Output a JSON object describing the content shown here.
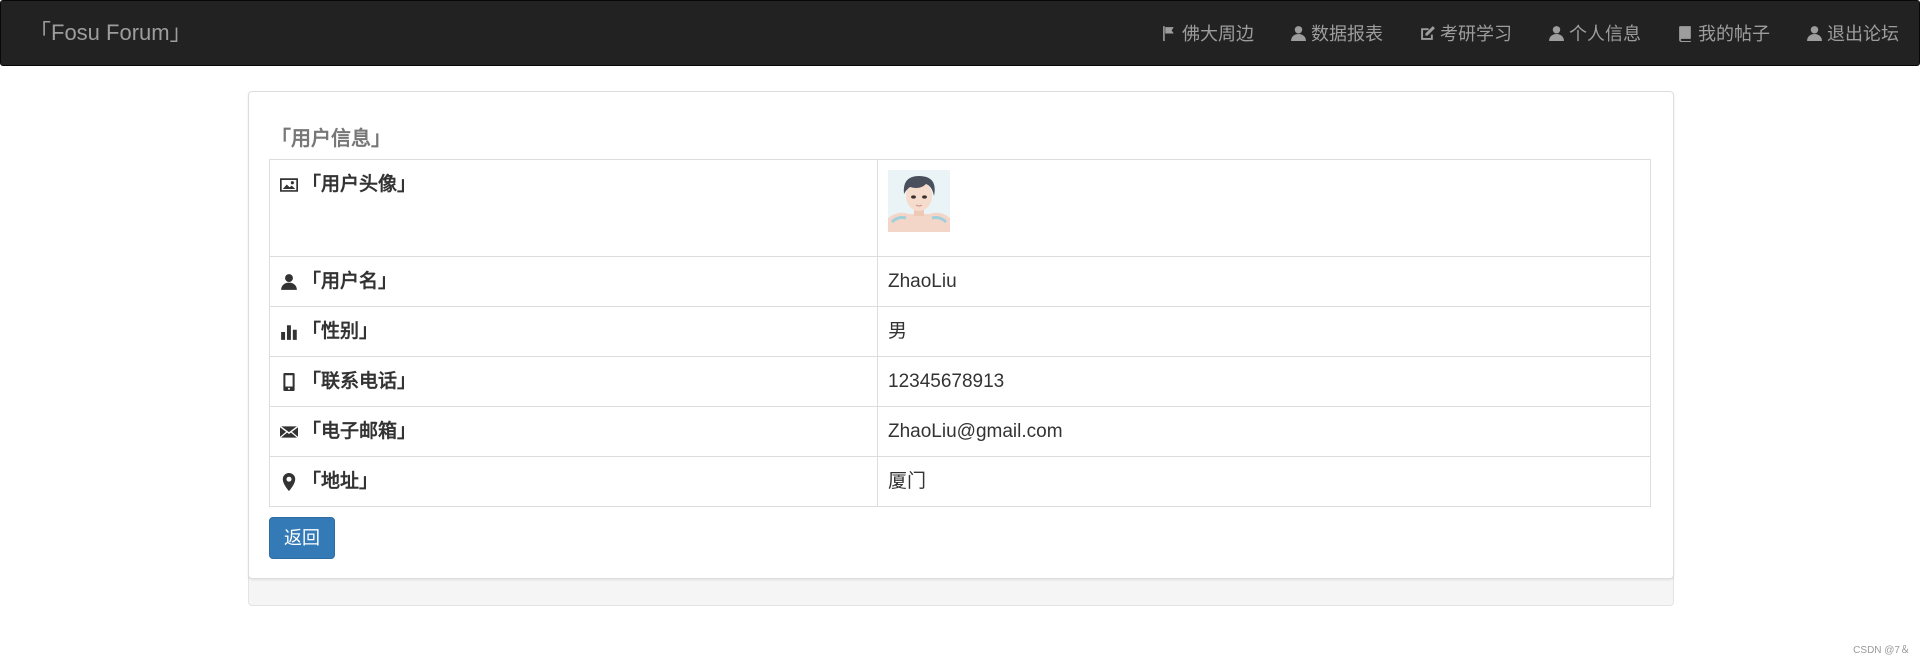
{
  "navbar": {
    "brand": "「Fosu Forum」",
    "items": [
      {
        "label": "佛大周边",
        "icon": "flag-icon"
      },
      {
        "label": "数据报表",
        "icon": "user-icon"
      },
      {
        "label": "考研学习",
        "icon": "edit-icon"
      },
      {
        "label": "个人信息",
        "icon": "user-icon"
      },
      {
        "label": "我的帖子",
        "icon": "book-icon"
      },
      {
        "label": "退出论坛",
        "icon": "user-icon"
      }
    ]
  },
  "panel": {
    "title": "「用户信息」",
    "rows": [
      {
        "label": "「用户头像」",
        "icon": "picture-icon",
        "value": ""
      },
      {
        "label": "「用户名」",
        "icon": "user-icon",
        "value": "ZhaoLiu"
      },
      {
        "label": "「性别」",
        "icon": "stats-icon",
        "value": "男"
      },
      {
        "label": "「联系电话」",
        "icon": "phone-icon",
        "value": "12345678913"
      },
      {
        "label": "「电子邮箱」",
        "icon": "envelope-icon",
        "value": "ZhaoLiu@gmail.com"
      },
      {
        "label": "「地址」",
        "icon": "map-marker-icon",
        "value": "厦门"
      }
    ],
    "back_label": "返回"
  },
  "watermark": "CSDN @7＆",
  "colors": {
    "navbar_bg": "#222222",
    "nav_text": "#9d9d9d",
    "button_primary": "#337ab7"
  }
}
